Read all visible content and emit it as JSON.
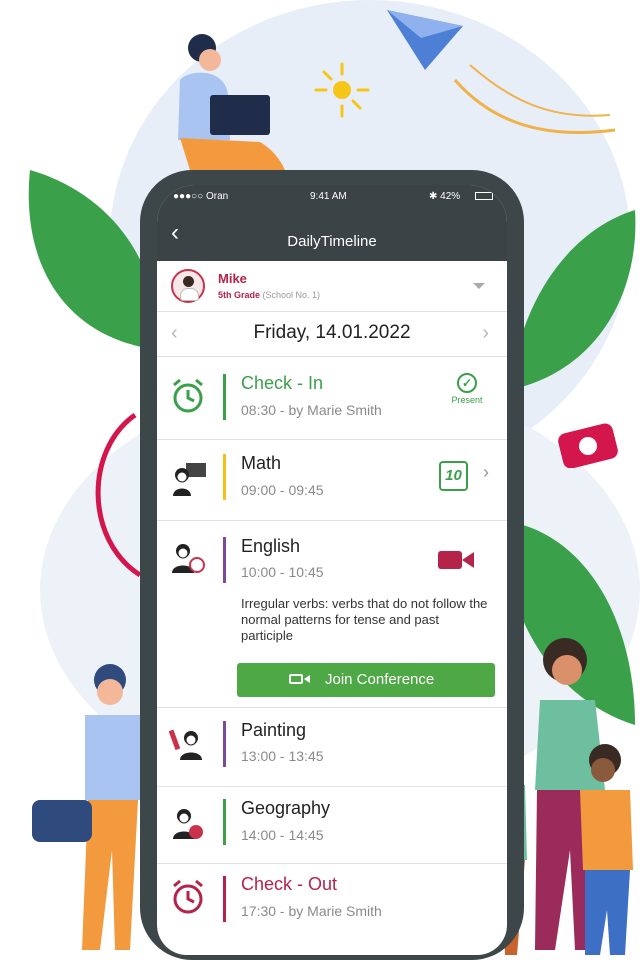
{
  "status": {
    "carrier": "●●●○○ Oran",
    "time": "9:41 AM",
    "battery": "✱ 42%"
  },
  "nav": {
    "back_icon": "‹",
    "title": "DailyTimeline"
  },
  "student": {
    "name": "Mike",
    "grade": "5th Grade",
    "school": "(School No. 1)"
  },
  "date": {
    "label": "Friday, 14.01.2022",
    "prev": "‹",
    "next": "›"
  },
  "events": [
    {
      "title": "Check - In",
      "time": "08:30 - by Marie Smith",
      "status": "Present",
      "status_mark": "✓",
      "color": "#3aa04a",
      "icon": "alarm-clock-icon"
    },
    {
      "title": "Math",
      "time": "09:00 - 09:45",
      "grade": "10",
      "chevron": "›",
      "color": "#f2c219",
      "icon": "teacher-blackboard-icon"
    },
    {
      "title": "English",
      "time": "10:00 - 10:45",
      "description": "Irregular verbs: verbs that do not follow the normal patterns for tense and past participle",
      "action": "Join Conference",
      "color": "#7b4a9c",
      "icon": "student-globe-icon"
    },
    {
      "title": "Painting",
      "time": "13:00 - 13:45",
      "color": "#7b4a9c",
      "icon": "student-paint-icon"
    },
    {
      "title": "Geography",
      "time": "14:00 - 14:45",
      "color": "#3aa04a",
      "icon": "student-earth-icon"
    },
    {
      "title": "Check - Out",
      "time": "17:30 - by Marie Smith",
      "color": "#b4234a",
      "icon": "alarm-clock-icon"
    }
  ],
  "colors": {
    "accent_green": "#4ea846",
    "accent_red": "#b4234a",
    "phone_frame": "#3d4649"
  }
}
